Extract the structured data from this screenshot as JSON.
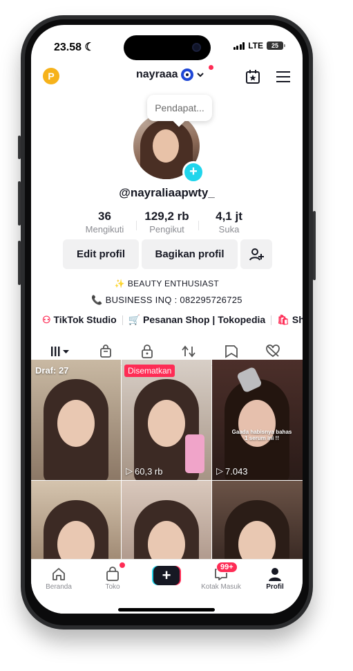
{
  "status": {
    "time": "23.58",
    "network": "LTE",
    "battery": "25"
  },
  "header": {
    "username": "nayraaa"
  },
  "tooltip": {
    "text": "Pendapat..."
  },
  "profile": {
    "handle": "@nayraliaapwty_",
    "stats": [
      {
        "value": "36",
        "label": "Mengikuti"
      },
      {
        "value": "129,2 rb",
        "label": "Pengikut"
      },
      {
        "value": "4,1 jt",
        "label": "Suka"
      }
    ],
    "buttons": {
      "edit": "Edit profil",
      "share": "Bagikan profil"
    },
    "bio": {
      "line1": "BEAUTY ENTHUSIAST",
      "line2": "BUSINESS INQ : 082295726725"
    }
  },
  "links": {
    "studio": "TikTok Studio",
    "shop": "Pesanan Shop | Tokopedia",
    "cut": "Sh"
  },
  "videos": {
    "drafts": "Draf: 27",
    "pinned": "Disematkan",
    "v2_views": "60,3 rb",
    "v3_views": "7.043",
    "v3_caption": "Gaada habisnya bahas 1 serum ini !!"
  },
  "nav": {
    "home": "Beranda",
    "shop": "Toko",
    "inbox": "Kotak Masuk",
    "inbox_badge": "99+",
    "profile": "Profil"
  },
  "colors": {
    "accent_red": "#fe2c55",
    "accent_cyan": "#20d5ec",
    "text": "#161823",
    "muted": "#8a8b91"
  }
}
